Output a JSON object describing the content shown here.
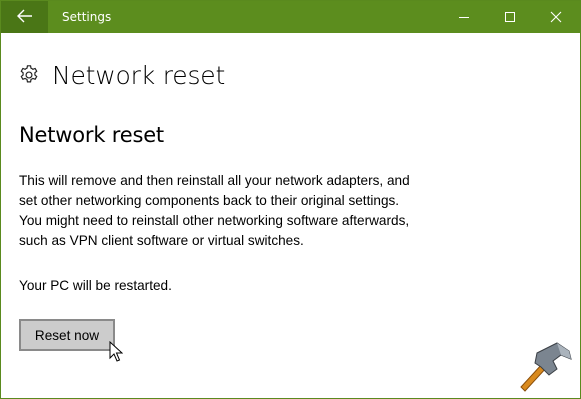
{
  "window": {
    "title": "Settings",
    "accent_color": "#5c8d1e",
    "back_button_color": "#4a7616"
  },
  "icons": {
    "back": "back-arrow-icon",
    "minimize": "minimize-icon",
    "maximize": "maximize-icon",
    "close": "close-icon",
    "settings": "gear-icon",
    "cursor": "mouse-pointer-icon",
    "logo": "hammer-logo-icon"
  },
  "header": {
    "title": "Network reset"
  },
  "section": {
    "title": "Network reset",
    "description_lines": [
      "This will remove and then reinstall all your network adapters, and",
      "set other networking components back to their original settings.",
      "You might need to reinstall other networking software afterwards,",
      "such as VPN client software or virtual switches."
    ],
    "restart_note": "Your PC will be restarted.",
    "reset_button_label": "Reset now"
  }
}
